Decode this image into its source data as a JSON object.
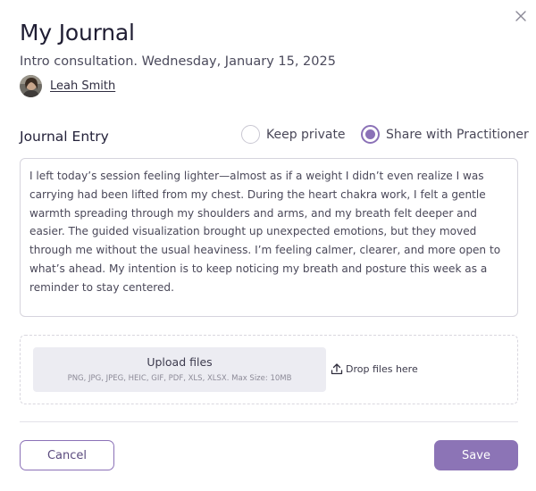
{
  "dialog": {
    "title": "My Journal",
    "subtitle": "Intro consultation. Wednesday, January 15, 2025",
    "user_name": "Leah Smith"
  },
  "journal": {
    "label": "Journal Entry",
    "options": [
      {
        "label": "Keep private",
        "selected": false
      },
      {
        "label": "Share with Practitioner",
        "selected": true
      }
    ],
    "entry_text": "I left today’s session feeling lighter—almost as if a weight I didn’t even realize I was carrying had been lifted from my chest. During the heart chakra work, I felt a gentle warmth spreading through my shoulders and arms, and my breath felt deeper and easier. The guided visualization brought up unexpected emotions, but they moved through me without the usual heaviness. I’m feeling calmer, clearer, and more open to what’s ahead. My intention is to keep noticing my breath and posture this week as a reminder to stay centered."
  },
  "upload": {
    "title": "Upload files",
    "hint": "PNG, JPG, JPEG, HEIC, GIF, PDF, XLS, XLSX. Max Size: 10MB",
    "drop_label": "Drop files here"
  },
  "actions": {
    "cancel_label": "Cancel",
    "save_label": "Save"
  },
  "colors": {
    "accent": "#8c74b6",
    "border": "#d6d4dd",
    "upload_bg": "#ececf2"
  },
  "icons": {
    "close": "close-icon",
    "upload": "upload-icon"
  }
}
